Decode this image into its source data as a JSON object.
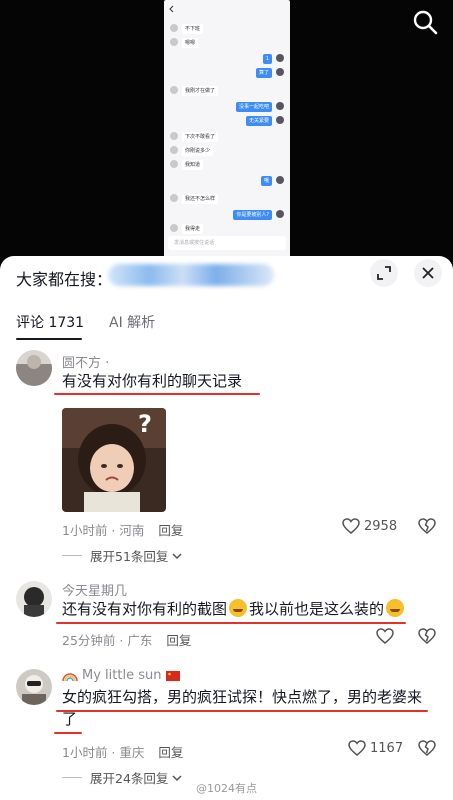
{
  "chat_screenshot": {
    "bubbles": [
      {
        "side": "l",
        "text": "不下班"
      },
      {
        "side": "l",
        "text": "嗯嗯"
      },
      {
        "side": "r",
        "text": "1"
      },
      {
        "side": "r",
        "text": "算了"
      },
      {
        "side": "l",
        "text": "我刚才在做了"
      },
      {
        "side": "r",
        "text": "没事一起吃吧"
      },
      {
        "side": "r",
        "text": "无关紧要"
      },
      {
        "side": "l",
        "text": "下次不敢看了"
      },
      {
        "side": "l",
        "text": "你刚说多少"
      },
      {
        "side": "l",
        "text": "我知道"
      },
      {
        "side": "r",
        "text": "哦"
      },
      {
        "side": "l",
        "text": "我还不怎么样"
      },
      {
        "side": "r",
        "text": "你是要被别人?"
      },
      {
        "side": "l",
        "text": "我得走"
      }
    ],
    "input_placeholder": "发消息或按住说话"
  },
  "header": {
    "search_label": "大家都在搜：",
    "tabs": [
      {
        "label": "评论 1731",
        "active": true
      },
      {
        "label": "AI 解析",
        "active": false
      }
    ]
  },
  "comments": [
    {
      "username": "圆不方 ·",
      "text": "有没有对你有利的聊天记录",
      "meta_time": "1小时前 · 河南",
      "reply_label": "回复",
      "likes": "2958",
      "has_image": true,
      "image_caption": "?",
      "expand_label": "展开51条回复"
    },
    {
      "username": "今天星期几",
      "text_before": "还有没有对你有利的截图",
      "text_middle": "我以前也是这么装的",
      "meta_time": "25分钟前 · 广东",
      "reply_label": "回复",
      "likes": ""
    },
    {
      "username": "My little sun",
      "text_line1": "女的疯狂勾搭，男的疯狂试探！快点燃了，男的老婆来",
      "text_line2": "了",
      "meta_time": "1小时前 · 重庆",
      "reply_label": "回复",
      "likes": "1167",
      "expand_label": "展开24条回复"
    }
  ],
  "watermark": "@1024有点",
  "colors": {
    "underline_red": "#e8302a",
    "panel_bg": "#ffffff",
    "chat_blue": "#3e8cf5"
  }
}
